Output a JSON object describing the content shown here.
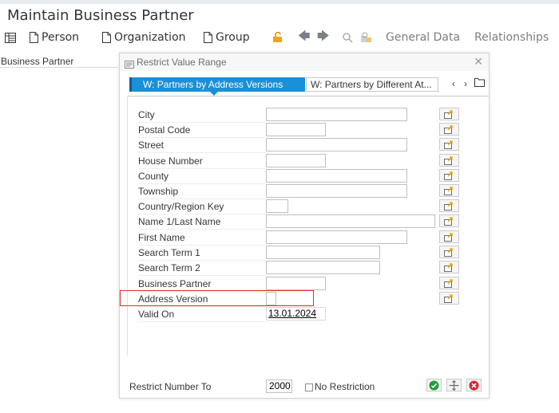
{
  "window": {
    "title": "Maintain Business Partner"
  },
  "toolbar": {
    "person": "Person",
    "organization": "Organization",
    "group": "Group",
    "general_data": "General Data",
    "relationships": "Relationships"
  },
  "sidebar": {
    "label": "Business Partner"
  },
  "dialog": {
    "title": "Restrict Value Range",
    "tabs": [
      {
        "label": "W: Partners by Address Versions",
        "active": true
      },
      {
        "label": "W: Partners by Different At...",
        "active": false
      }
    ],
    "fields": [
      {
        "label": "City",
        "value": ""
      },
      {
        "label": "Postal Code",
        "value": ""
      },
      {
        "label": "Street",
        "value": ""
      },
      {
        "label": "House Number",
        "value": ""
      },
      {
        "label": "County",
        "value": ""
      },
      {
        "label": "Township",
        "value": ""
      },
      {
        "label": "Country/Region Key",
        "value": ""
      },
      {
        "label": "Name 1/Last Name",
        "value": ""
      },
      {
        "label": "First Name",
        "value": ""
      },
      {
        "label": "Search Term 1",
        "value": ""
      },
      {
        "label": "Search Term 2",
        "value": ""
      },
      {
        "label": "Business Partner",
        "value": ""
      },
      {
        "label": "Address Version",
        "value": ""
      }
    ],
    "valid_on": {
      "label": "Valid On",
      "value": "13.01.2024"
    },
    "restrict_number": {
      "label": "Restrict Number To",
      "value": "2000"
    },
    "no_restriction": {
      "label": "No Restriction",
      "checked": false
    }
  },
  "colors": {
    "accent": "#1b8fd7",
    "highlight": "#e0302e",
    "ok": "#1e9e3a",
    "cancel": "#d9262c"
  }
}
